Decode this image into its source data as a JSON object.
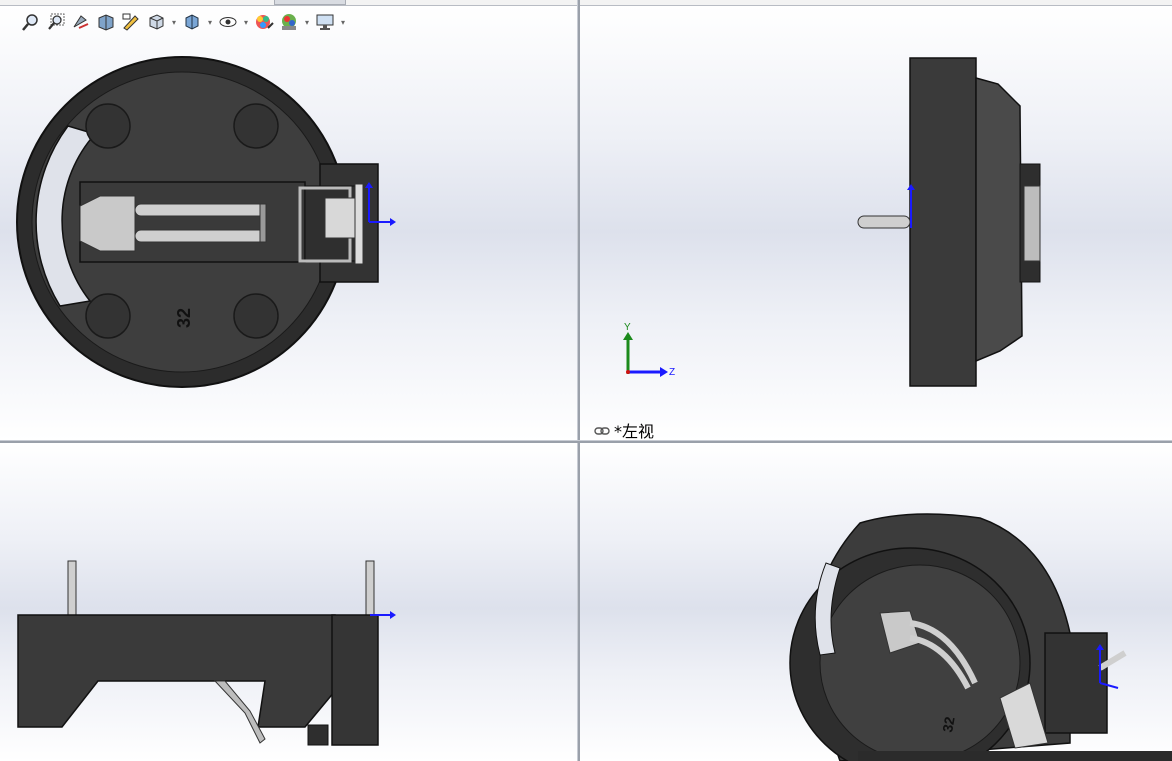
{
  "toolbar": {
    "items": [
      {
        "icon": "zoom-to-fit-icon",
        "has_dropdown": false
      },
      {
        "icon": "zoom-to-area-icon",
        "has_dropdown": false
      },
      {
        "icon": "previous-view-icon",
        "has_dropdown": false
      },
      {
        "icon": "section-view-icon",
        "has_dropdown": false
      },
      {
        "icon": "dynamic-annotation-icon",
        "has_dropdown": false
      },
      {
        "icon": "view-orientation-icon",
        "has_dropdown": true
      },
      {
        "icon": "display-style-icon",
        "has_dropdown": true
      },
      {
        "icon": "hide-show-items-icon",
        "has_dropdown": true
      },
      {
        "icon": "edit-appearance-icon",
        "has_dropdown": false
      },
      {
        "icon": "apply-scene-icon",
        "has_dropdown": true
      },
      {
        "icon": "view-settings-icon",
        "has_dropdown": true
      }
    ]
  },
  "viewports": {
    "top_right": {
      "label": "*左视",
      "triad": {
        "y_label": "Y",
        "z_label": "Z"
      }
    }
  },
  "part": {
    "engraving": "32"
  },
  "colors": {
    "body_dark": "#3a3a3a",
    "body_outline": "#111111",
    "metal": "#c9c9c9",
    "axis_blue": "#1a1aff",
    "axis_green": "#1b8a1b",
    "axis_red": "#d01010",
    "background_band": "#dde1ec"
  }
}
